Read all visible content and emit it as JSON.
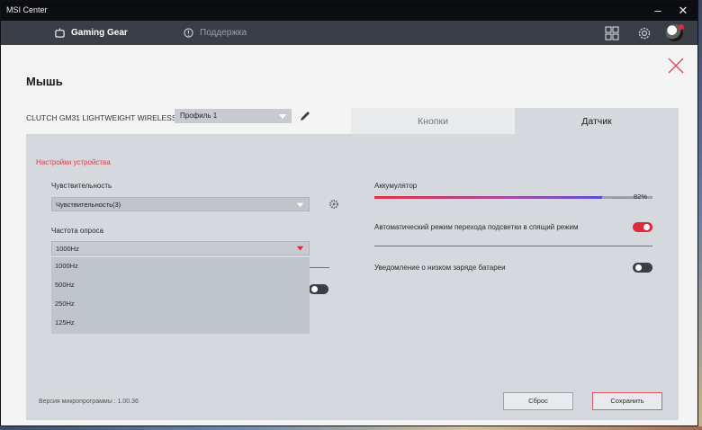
{
  "window": {
    "title": "MSI Center"
  },
  "nav": {
    "tabs": [
      {
        "label": "Gaming Gear",
        "icon": "gamepad-icon",
        "active": true
      },
      {
        "label": "Поддержка",
        "icon": "support-icon",
        "active": false
      }
    ]
  },
  "page": {
    "title": "Мышь"
  },
  "device": {
    "name": "CLUTCH GM31 LIGHTWEIGHT WIRELESS",
    "profile": "Профиль 1"
  },
  "tabs": [
    {
      "label": "Кнопки",
      "active": false
    },
    {
      "label": "Датчик",
      "active": true
    }
  ],
  "settings": {
    "section_title": "Настройки устройства",
    "sensitivity": {
      "label": "Чувствительность",
      "value": "Чувствительность(3)"
    },
    "polling": {
      "label": "Частота опроса",
      "value": "1000Hz",
      "options": [
        "1000Hz",
        "500Hz",
        "250Hz",
        "125Hz"
      ]
    },
    "hidden_toggle": {
      "on": false
    }
  },
  "battery": {
    "label": "Аккумулятор",
    "percent_text": "82%",
    "level": 0.82
  },
  "auto_sleep": {
    "label": "Автоматический режим перехода подсветки в спящий режим",
    "on": true
  },
  "low_battery": {
    "label": "Уведомление о низком заряде батареи",
    "on": false
  },
  "footer": {
    "firmware": "Версия микропрограммы : 1.00.36",
    "reset_label": "Сброс",
    "save_label": "Сохранить"
  },
  "colors": {
    "accent": "#e0293a",
    "toggle_off": "#3a3f47"
  }
}
